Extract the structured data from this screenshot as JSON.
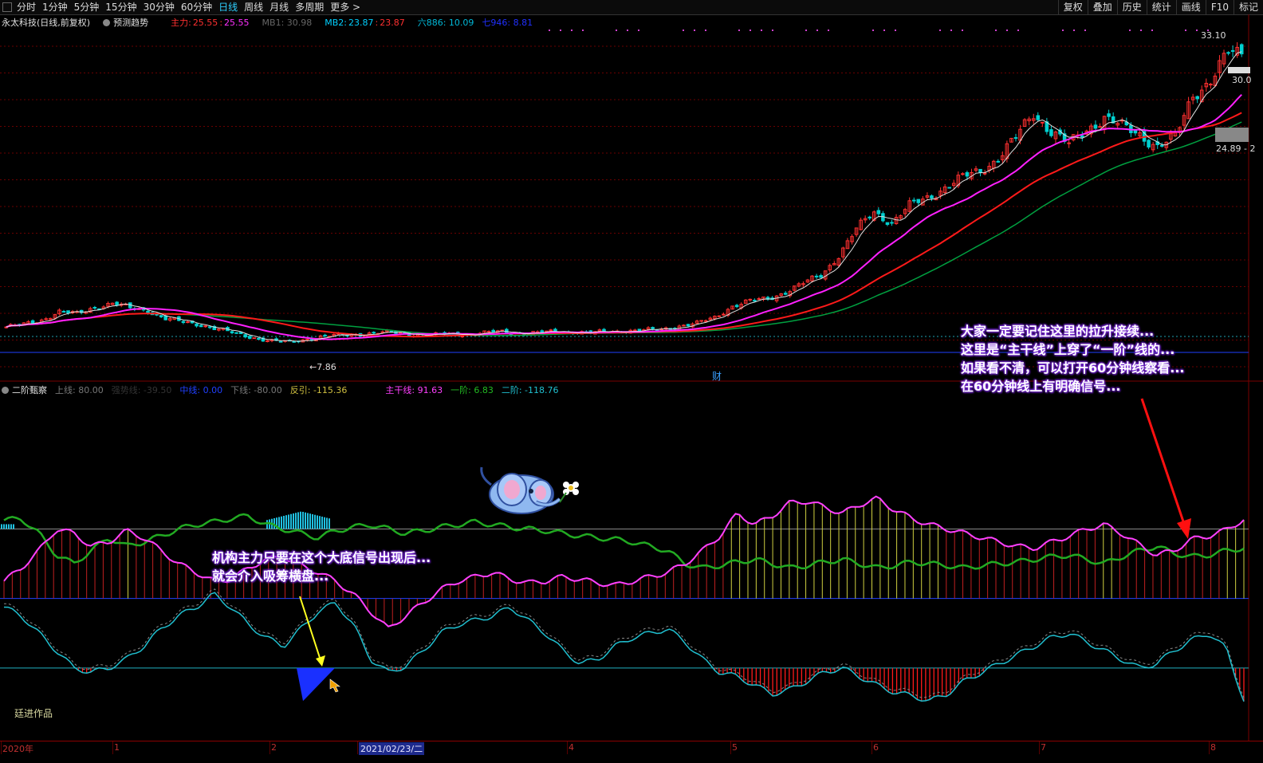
{
  "toolbar": {
    "left": [
      "分时",
      "1分钟",
      "5分钟",
      "15分钟",
      "30分钟",
      "60分钟",
      "日线",
      "周线",
      "月线",
      "多周期",
      "更多 >"
    ],
    "active": "日线",
    "right": [
      "复权",
      "叠加",
      "历史",
      "统计",
      "画线",
      "F10",
      "标记"
    ]
  },
  "main_info": {
    "title": "永太科技(日线,前复权)",
    "forecast": "预测趋势",
    "zhuli_label": "主力:",
    "zhuli_a": "25.55",
    "zhuli_b": "25.55",
    "mb1": "MB1: 30.98",
    "mb2_label": "MB2:",
    "mb2_a": "23.87",
    "mb2_b": "23.87",
    "liu": "六886: 10.09",
    "qi": "七946: 8.81"
  },
  "price_labels": {
    "high": "33.10",
    "level": "30.0",
    "range": "24.89 - 2",
    "low": "7.86",
    "cai": "财"
  },
  "ind_info": {
    "name": "二阶甄察",
    "up": "上线: 80.00",
    "strong": "强势线: -39.50",
    "mid": "中线: 0.00",
    "down": "下线: -80.00",
    "fanyin": "反引: -115.36",
    "zhugan": "主干线: 91.63",
    "yijie": "一阶: 6.83",
    "erjie": "二阶: -118.76"
  },
  "annotations": {
    "right": [
      "大家一定要记住这里的拉升接续...",
      "这里是“主干线”上穿了“一阶”线的...",
      "如果看不清，可以打开60分钟线察看...",
      "在60分钟线上有明确信号..."
    ],
    "left": [
      "机构主力只要在这个大底信号出现后...",
      "就会介入吸筹横盘..."
    ],
    "author": "廷进作品"
  },
  "date_axis": {
    "labels": [
      "2020年",
      "1",
      "2",
      "2021/02/23/二",
      "4",
      "5",
      "6",
      "7",
      "8"
    ]
  },
  "colors": {
    "bg": "#000000",
    "up": "#ff3030",
    "down": "#00d0d0",
    "ma_white": "#e0e0e0",
    "ma_magenta": "#ff20ff",
    "ma_red": "#ff1a1a",
    "ma_green": "#00a040",
    "line_magenta": "#ff40ff",
    "line_green": "#22aa22",
    "line_cyan": "#20c0d0",
    "annot_shadow": "#7b2bd8"
  },
  "chart_data": {
    "type": "candlestick",
    "title": "永太科技(日线,前复权)",
    "price_range": [
      5,
      35
    ],
    "markers": {
      "max": 33.1,
      "min": 7.86
    },
    "close_path": [
      9.2,
      9.4,
      9.8,
      10.5,
      10.3,
      10.9,
      11.2,
      10.8,
      10.6,
      9.9,
      9.6,
      9.4,
      9.0,
      8.6,
      8.3,
      8.0,
      7.9,
      8.2,
      8.4,
      8.5,
      8.6,
      8.7,
      8.7,
      8.6,
      8.5,
      8.6,
      8.6,
      8.7,
      8.8,
      8.7,
      8.7,
      8.8,
      8.8,
      8.7,
      8.8,
      8.9,
      8.9,
      9.0,
      9.3,
      9.5,
      10.0,
      11.0,
      11.4,
      11.6,
      12.2,
      12.9,
      13.6,
      15.3,
      17.5,
      19.0,
      18.1,
      19.5,
      20.2,
      21.1,
      21.9,
      22.5,
      23.6,
      25.3,
      27.4,
      25.9,
      24.7,
      26.0,
      27.1,
      26.2,
      25.6,
      24.6,
      25.3,
      29.0,
      30.2,
      32.5
    ],
    "indicator": {
      "name": "二阶甄察",
      "lines": {
        "上线": 80.0,
        "强势线": -39.5,
        "中线": 0.0,
        "下线": -80.0
      },
      "反引": -115.36,
      "主干线": 91.63,
      "一阶": 6.83,
      "二阶": -118.76,
      "zhugan_path": [
        20,
        35,
        55,
        80,
        75,
        60,
        65,
        78,
        70,
        55,
        40,
        30,
        20,
        22,
        35,
        45,
        48,
        38,
        30,
        20,
        5,
        -15,
        -35,
        -20,
        -5,
        10,
        20,
        25,
        30,
        22,
        18,
        20,
        25,
        22,
        18,
        15,
        20,
        25,
        30,
        40,
        55,
        72,
        98,
        85,
        95,
        110,
        112,
        105,
        98,
        108,
        115,
        102,
        92,
        85,
        80,
        75,
        70,
        65,
        60,
        58,
        65,
        72,
        80,
        85,
        75,
        62,
        50,
        55,
        68,
        72,
        79,
        91
      ],
      "yijie_path": [
        -10,
        -20,
        -40,
        -60,
        -80,
        -85,
        -80,
        -70,
        -55,
        -35,
        -20,
        -10,
        5,
        -10,
        -30,
        -45,
        -55,
        -35,
        -15,
        -5,
        -30,
        -70,
        -85,
        -78,
        -60,
        -40,
        -30,
        -25,
        -20,
        -10,
        -25,
        -40,
        -60,
        -75,
        -70,
        -55,
        -45,
        -40,
        -35,
        -50,
        -70,
        -85,
        -90,
        -100,
        -110,
        -105,
        -95,
        -85,
        -80,
        -90,
        -100,
        -108,
        -112,
        -118,
        -110,
        -95,
        -85,
        -75,
        -65,
        -55,
        -45,
        -40,
        -50,
        -60,
        -70,
        -80,
        -75,
        -60,
        -48,
        -40,
        -58,
        -118
      ],
      "green_path": [
        60,
        62,
        45,
        20,
        10,
        25,
        40,
        30,
        35,
        42,
        50,
        55,
        58,
        62,
        65,
        55,
        50,
        45,
        40,
        48,
        52,
        55,
        50,
        45,
        48,
        52,
        55,
        58,
        55,
        52,
        50,
        48,
        45,
        42,
        40,
        38,
        35,
        30,
        25,
        10,
        5,
        8,
        12,
        15,
        10,
        5,
        8,
        12,
        15,
        10,
        5,
        8,
        12,
        10,
        8,
        5,
        8,
        10,
        12,
        15,
        18,
        20,
        15,
        10,
        18,
        25,
        30,
        22,
        18,
        20,
        25,
        28
      ]
    }
  }
}
